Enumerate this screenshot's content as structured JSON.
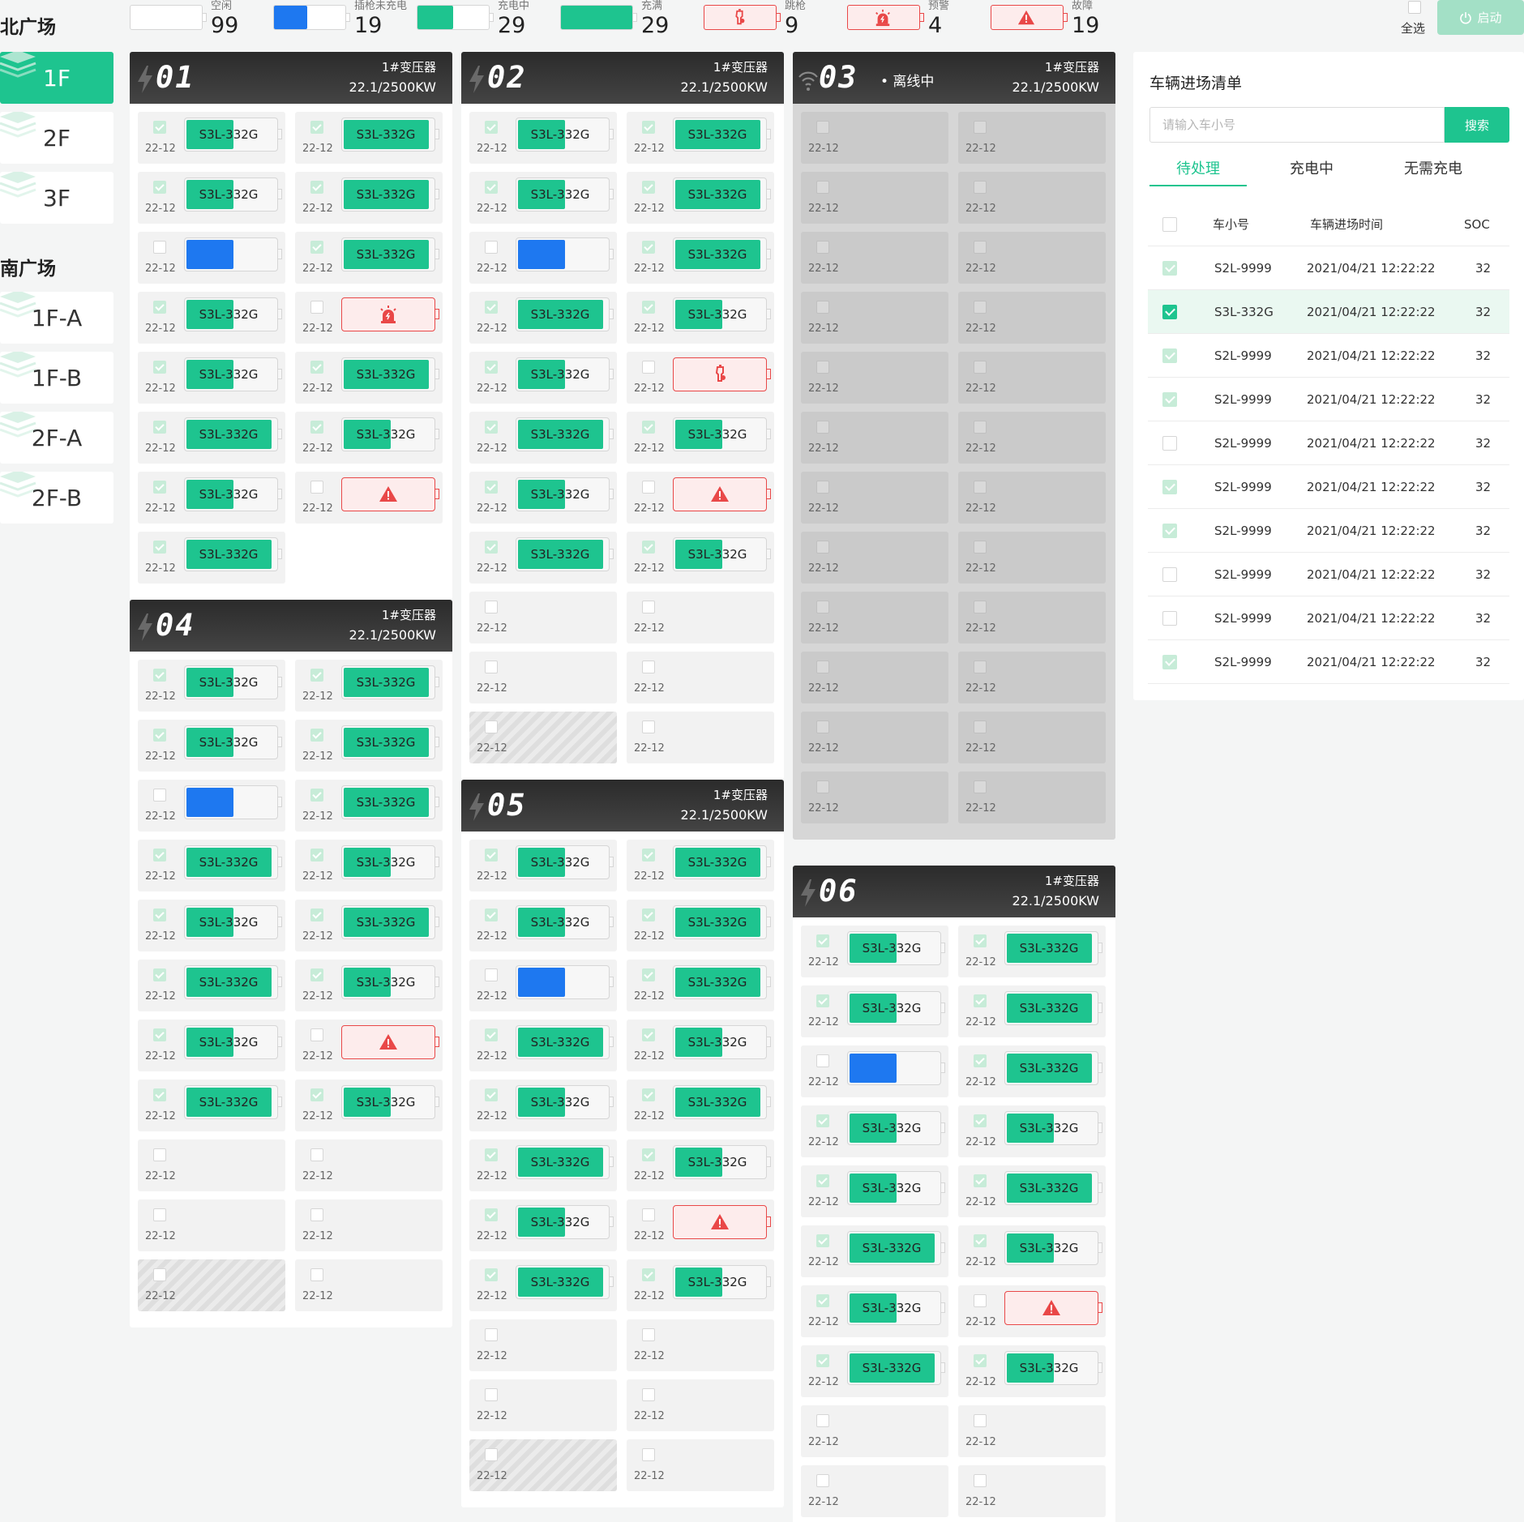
{
  "status_counts": [
    {
      "label": "空闲",
      "count": "99",
      "kind": "empty",
      "color": "#ffffff",
      "fill": 0
    },
    {
      "label": "插枪未充电",
      "count": "19",
      "kind": "plugged",
      "color": "#1e78f0",
      "fill": 0.47
    },
    {
      "label": "充电中",
      "count": "29",
      "kind": "charging",
      "color": "#1ec48f",
      "fill": 0.5
    },
    {
      "label": "充满",
      "count": "29",
      "kind": "full",
      "color": "#1ec48f",
      "fill": 1
    },
    {
      "label": "跳枪",
      "count": "9",
      "kind": "gun",
      "color": "#e94848",
      "fill": 0
    },
    {
      "label": "预警",
      "count": "4",
      "kind": "warn",
      "color": "#e94848",
      "fill": 0
    },
    {
      "label": "故障",
      "count": "19",
      "kind": "fault",
      "color": "#e94848",
      "fill": 0
    }
  ],
  "controls": {
    "select_all": "全选",
    "start": "启动"
  },
  "nav": {
    "north": {
      "title": "北广场",
      "items": [
        "1F",
        "2F",
        "3F"
      ],
      "active": 0
    },
    "south": {
      "title": "南广场",
      "items": [
        "1F-A",
        "1F-B",
        "2F-A",
        "2F-B"
      ]
    }
  },
  "groups": [
    {
      "num": "01",
      "transformer": "1#变压器",
      "power": "22.1/2500KW",
      "status": "",
      "slots": [
        "C",
        "F",
        "C",
        "F",
        "P",
        "F",
        "C",
        "W",
        "C",
        "F",
        "F",
        "C",
        "C",
        "X",
        "F"
      ]
    },
    {
      "num": "02",
      "transformer": "1#变压器",
      "power": "22.1/2500KW",
      "status": "",
      "slots": [
        "C",
        "F",
        "C",
        "F",
        "P",
        "F",
        "F",
        "C",
        "C",
        "G",
        "F",
        "C",
        "C",
        "X",
        "F",
        "C",
        "E",
        "E",
        "E",
        "E",
        "H",
        "E"
      ]
    },
    {
      "num": "03",
      "transformer": "1#变压器",
      "power": "22.1/2500KW",
      "status": "离线中",
      "offline": true,
      "slots": [
        "E",
        "E",
        "E",
        "E",
        "E",
        "E",
        "E",
        "E",
        "E",
        "E",
        "E",
        "E",
        "E",
        "E",
        "E",
        "E",
        "E",
        "E",
        "E",
        "E",
        "E",
        "E",
        "E",
        "E"
      ]
    },
    {
      "num": "04",
      "transformer": "1#变压器",
      "power": "22.1/2500KW",
      "status": "",
      "slots": [
        "C",
        "F",
        "C",
        "F",
        "P",
        "F",
        "F",
        "C",
        "C",
        "F",
        "F",
        "C",
        "C",
        "X",
        "F",
        "C",
        "E",
        "E",
        "E",
        "E",
        "H",
        "E"
      ]
    },
    {
      "num": "05",
      "transformer": "1#变压器",
      "power": "22.1/2500KW",
      "status": "",
      "slots": [
        "C",
        "F",
        "C",
        "F",
        "P",
        "F",
        "F",
        "C",
        "C",
        "F",
        "F",
        "C",
        "C",
        "X",
        "F",
        "C",
        "E",
        "E",
        "E",
        "E",
        "H",
        "E"
      ]
    },
    {
      "num": "06",
      "transformer": "1#变压器",
      "power": "22.1/2500KW",
      "status": "",
      "slots": [
        "C",
        "F",
        "C",
        "F",
        "P",
        "F",
        "C",
        "C",
        "C",
        "F",
        "F",
        "C",
        "C",
        "X",
        "F",
        "C",
        "E",
        "E",
        "E",
        "E"
      ]
    }
  ],
  "slot_text": {
    "plate": "S3L-332G",
    "date": "22-12"
  },
  "panel": {
    "title": "车辆进场清单",
    "search_placeholder": "请输入车小号",
    "search_btn": "搜索",
    "tabs": [
      "待处理",
      "充电中",
      "无需充电"
    ],
    "columns": [
      "车小号",
      "车辆进场时间",
      "SOC"
    ],
    "rows": [
      {
        "plate": "S2L-9999",
        "time": "2021/04/21 12:22:22",
        "soc": "32",
        "check": "on"
      },
      {
        "plate": "S3L-332G",
        "time": "2021/04/21 12:22:22",
        "soc": "32",
        "check": "dark",
        "hl": true
      },
      {
        "plate": "S2L-9999",
        "time": "2021/04/21 12:22:22",
        "soc": "32",
        "check": "on"
      },
      {
        "plate": "S2L-9999",
        "time": "2021/04/21 12:22:22",
        "soc": "32",
        "check": "on"
      },
      {
        "plate": "S2L-9999",
        "time": "2021/04/21 12:22:22",
        "soc": "32",
        "check": "off"
      },
      {
        "plate": "S2L-9999",
        "time": "2021/04/21 12:22:22",
        "soc": "32",
        "check": "on"
      },
      {
        "plate": "S2L-9999",
        "time": "2021/04/21 12:22:22",
        "soc": "32",
        "check": "on"
      },
      {
        "plate": "S2L-9999",
        "time": "2021/04/21 12:22:22",
        "soc": "32",
        "check": "off"
      },
      {
        "plate": "S2L-9999",
        "time": "2021/04/21 12:22:22",
        "soc": "32",
        "check": "off"
      },
      {
        "plate": "S2L-9999",
        "time": "2021/04/21 12:22:22",
        "soc": "32",
        "check": "on"
      }
    ]
  }
}
